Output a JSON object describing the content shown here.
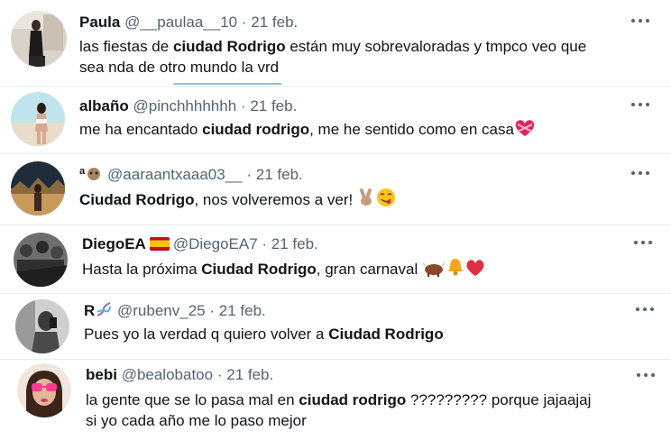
{
  "tweets": [
    {
      "name": "Paula",
      "handle": "@__paulaa__10",
      "dot": "·",
      "date": "21 feb.",
      "text1": "las fiestas de ",
      "bold1": "ciudad Rodrigo",
      "text2": " están muy sobrevaloradas y tmpco veo que",
      "line2": "sea  nda de otro mundo la vrd"
    },
    {
      "name": "albaño",
      "handle": "@pinchhhhhhh",
      "dot": "·",
      "date": "21 feb.",
      "text1": "me ha encantado ",
      "bold1": "ciudad rodrigo",
      "text2": ", me he sentido como en casa",
      "emoji": "heart-with-ribbon"
    },
    {
      "name": "ª",
      "name_icon": "sloth-emoji",
      "handle": "@aaraantxaaa03__",
      "dot": "·",
      "date": "21 feb.",
      "bold1": "Ciudad Rodrigo",
      "text2": ", nos volveremos a ver! ",
      "emojis": [
        "victory-hand",
        "face-savoring-food"
      ]
    },
    {
      "name": "DiegoEA",
      "name_icon": "spain-flag",
      "handle": "@DiegoEA7",
      "dot": "·",
      "date": "21 feb.",
      "text1": "Hasta la próxima ",
      "bold1": "Ciudad Rodrigo",
      "text2": ", gran carnaval ",
      "emojis": [
        "ox",
        "bell",
        "red-heart"
      ]
    },
    {
      "name": "R",
      "name_icon": "dna-emoji",
      "handle": "@rubenv_25",
      "dot": "·",
      "date": "21 feb.",
      "text1": "Pues yo la verdad q quiero volver a ",
      "bold1": "Ciudad Rodrigo"
    },
    {
      "name": "bebi",
      "handle": "@bealobatoo",
      "dot": "·",
      "date": "21 feb.",
      "text1": "la gente que se lo pasa mal en ",
      "bold1": "ciudad rodrigo",
      "text2": " ?????????  porque jajaajaj",
      "line2": "si yo cada año me lo paso mejor"
    }
  ],
  "more_icon": "more-options-icon",
  "colors": {
    "text": "#0f1419",
    "meta": "#536471",
    "separator": "#e8ecee",
    "heart": "#e0245e"
  }
}
